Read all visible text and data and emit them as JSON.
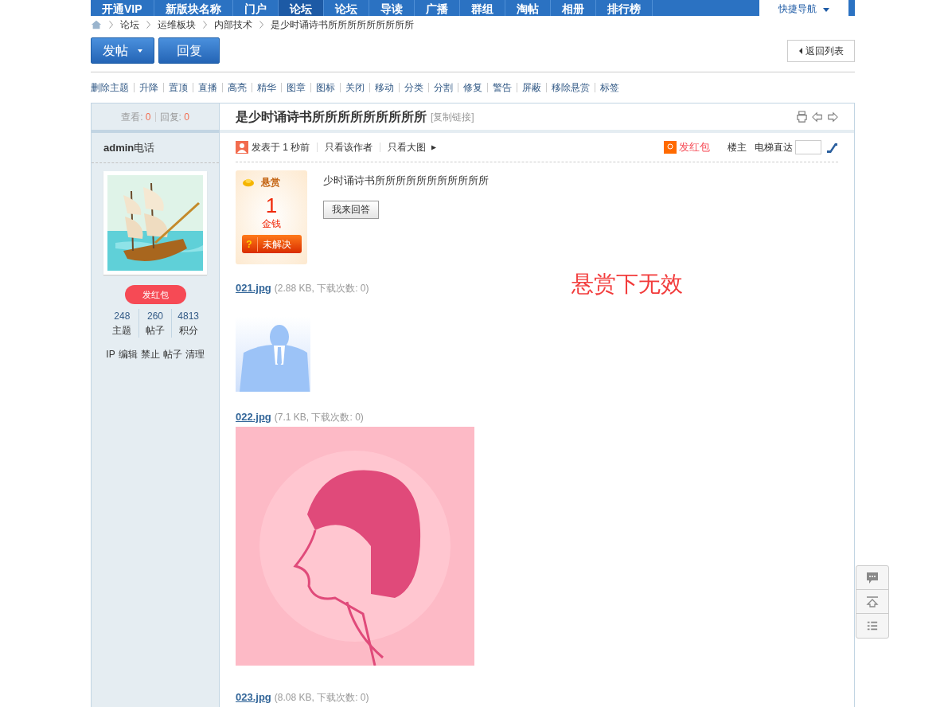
{
  "nav": {
    "items": [
      {
        "label": "开通VIP",
        "selected": false
      },
      {
        "label": "新版块名称",
        "selected": false
      },
      {
        "label": "门户",
        "selected": false
      },
      {
        "label": "论坛",
        "selected": true
      },
      {
        "label": "论坛",
        "selected": false
      },
      {
        "label": "导读",
        "selected": false
      },
      {
        "label": "广播",
        "selected": false
      },
      {
        "label": "群组",
        "selected": false
      },
      {
        "label": "淘帖",
        "selected": false
      },
      {
        "label": "相册",
        "selected": false
      },
      {
        "label": "排行榜",
        "selected": false
      }
    ],
    "quick_nav": "快捷导航"
  },
  "breadcrumb": [
    "论坛",
    "运维板块",
    "内部技术",
    "是少时诵诗书所所所所所所所所所"
  ],
  "actions": {
    "post_button": "发帖",
    "reply_button": "回复",
    "back_link": "返回列表"
  },
  "mod_tools": [
    "删除主题",
    "升降",
    "置顶",
    "直播",
    "高亮",
    "精华",
    "图章",
    "图标",
    "关闭",
    "移动",
    "分类",
    "分割",
    "修复",
    "警告",
    "屏蔽",
    "移除悬赏",
    "标签"
  ],
  "thread": {
    "views_label": "查看:",
    "views": "0",
    "replies_label": "回复:",
    "replies": "0",
    "title": "是少时诵诗书所所所所所所所所所",
    "copy_link": "[复制链接]"
  },
  "author": {
    "name": "admin",
    "name_suffix": "电话",
    "red_packet_button": "发红包",
    "stats": [
      {
        "value": "248",
        "label": "主题"
      },
      {
        "value": "260",
        "label": "帖子"
      },
      {
        "value": "4813",
        "label": "积分"
      }
    ],
    "admin_links": [
      "IP",
      "编辑",
      "禁止",
      "帖子",
      "清理"
    ]
  },
  "post": {
    "meta": "发表于 1 秒前",
    "links": [
      "只看该作者",
      "只看大图"
    ],
    "red_packet": "发红包",
    "floor": "楼主",
    "jump_label": "电梯直达",
    "reward": {
      "title": "悬赏",
      "amount": "1",
      "unit": "金钱",
      "status_icon": "?",
      "status": "未解决"
    },
    "body": "少时诵诗书所所所所所所所所所所所",
    "answer_button": "我来回答",
    "note": "悬赏下无效",
    "attachments": [
      {
        "name": "021.jpg",
        "info": "(2.88 KB, 下载次数: 0)",
        "kind": "picture"
      },
      {
        "name": "022.jpg",
        "info": "(7.1 KB, 下载次数: 0)",
        "kind": "picture"
      },
      {
        "name": "023.jpg",
        "info": "(8.08 KB, 下载次数: 0)"
      }
    ]
  }
}
